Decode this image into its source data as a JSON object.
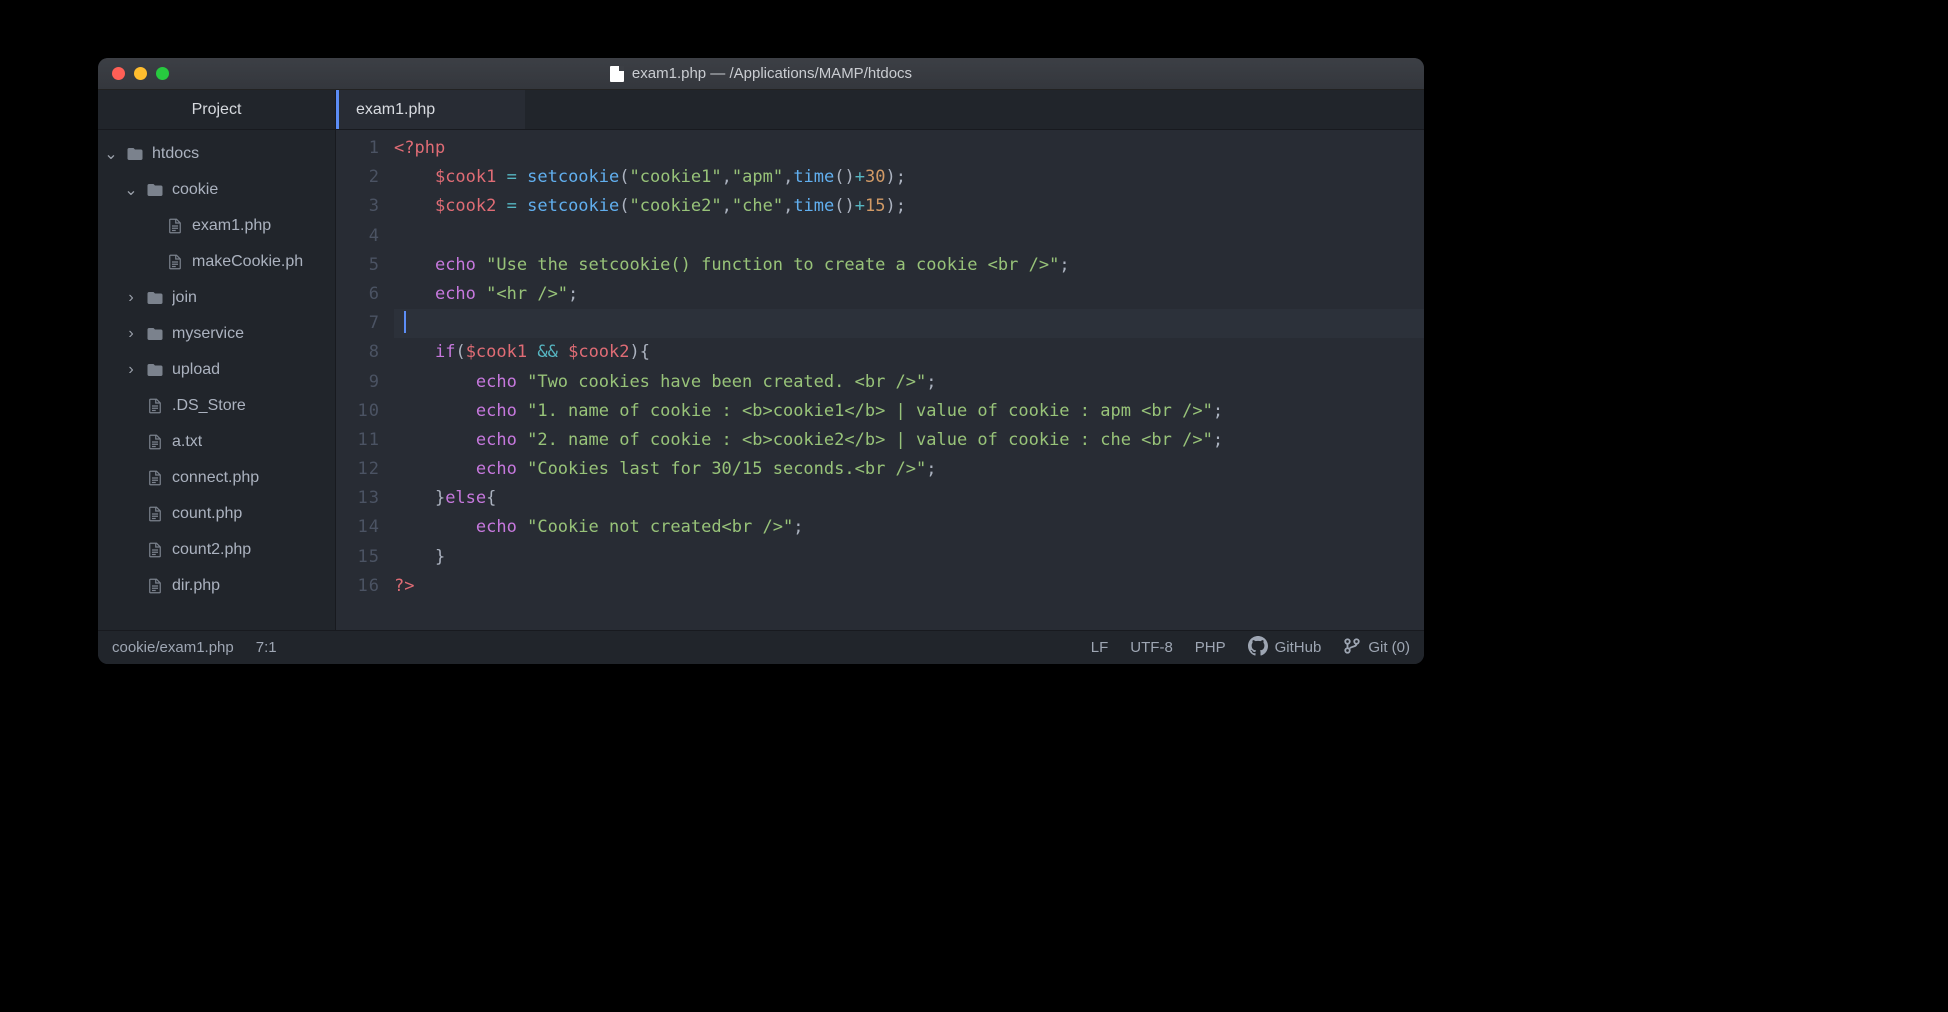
{
  "title": "exam1.php — /Applications/MAMP/htdocs",
  "sidebar": {
    "header": "Project",
    "tree": [
      {
        "type": "folder",
        "open": "down",
        "label": "htdocs",
        "depth": 0
      },
      {
        "type": "folder",
        "open": "down",
        "label": "cookie",
        "depth": 1
      },
      {
        "type": "file",
        "label": "exam1.php",
        "depth": 2
      },
      {
        "type": "file",
        "label": "makeCookie.ph",
        "depth": 2
      },
      {
        "type": "folder",
        "open": "right",
        "label": "join",
        "depth": 1
      },
      {
        "type": "folder",
        "open": "right",
        "label": "myservice",
        "depth": 1
      },
      {
        "type": "folder",
        "open": "right",
        "label": "upload",
        "depth": 1
      },
      {
        "type": "file",
        "label": ".DS_Store",
        "depth": 1
      },
      {
        "type": "file",
        "label": "a.txt",
        "depth": 1
      },
      {
        "type": "file",
        "label": "connect.php",
        "depth": 1
      },
      {
        "type": "file",
        "label": "count.php",
        "depth": 1
      },
      {
        "type": "file",
        "label": "count2.php",
        "depth": 1
      },
      {
        "type": "file",
        "label": "dir.php",
        "depth": 1
      }
    ]
  },
  "tab": {
    "label": "exam1.php"
  },
  "code_lines": 16,
  "current_line": 7,
  "code": {
    "l1": [
      {
        "t": "<?php",
        "c": "red"
      }
    ],
    "l2": [
      {
        "t": "    ",
        "c": "gray"
      },
      {
        "t": "$cook1",
        "c": "red"
      },
      {
        "t": " ",
        "c": "gray"
      },
      {
        "t": "=",
        "c": "cyan"
      },
      {
        "t": " ",
        "c": "gray"
      },
      {
        "t": "setcookie",
        "c": "blue"
      },
      {
        "t": "(",
        "c": "gray"
      },
      {
        "t": "\"cookie1\"",
        "c": "green"
      },
      {
        "t": ",",
        "c": "gray"
      },
      {
        "t": "\"apm\"",
        "c": "green"
      },
      {
        "t": ",",
        "c": "gray"
      },
      {
        "t": "time",
        "c": "blue"
      },
      {
        "t": "()",
        "c": "gray"
      },
      {
        "t": "+",
        "c": "cyan"
      },
      {
        "t": "30",
        "c": "orange"
      },
      {
        "t": ");",
        "c": "gray"
      }
    ],
    "l3": [
      {
        "t": "    ",
        "c": "gray"
      },
      {
        "t": "$cook2",
        "c": "red"
      },
      {
        "t": " ",
        "c": "gray"
      },
      {
        "t": "=",
        "c": "cyan"
      },
      {
        "t": " ",
        "c": "gray"
      },
      {
        "t": "setcookie",
        "c": "blue"
      },
      {
        "t": "(",
        "c": "gray"
      },
      {
        "t": "\"cookie2\"",
        "c": "green"
      },
      {
        "t": ",",
        "c": "gray"
      },
      {
        "t": "\"che\"",
        "c": "green"
      },
      {
        "t": ",",
        "c": "gray"
      },
      {
        "t": "time",
        "c": "blue"
      },
      {
        "t": "()",
        "c": "gray"
      },
      {
        "t": "+",
        "c": "cyan"
      },
      {
        "t": "15",
        "c": "orange"
      },
      {
        "t": ");",
        "c": "gray"
      }
    ],
    "l4": [],
    "l5": [
      {
        "t": "    ",
        "c": "gray"
      },
      {
        "t": "echo",
        "c": "purple"
      },
      {
        "t": " ",
        "c": "gray"
      },
      {
        "t": "\"Use the setcookie() function to create a cookie <br />\"",
        "c": "green"
      },
      {
        "t": ";",
        "c": "gray"
      }
    ],
    "l6": [
      {
        "t": "    ",
        "c": "gray"
      },
      {
        "t": "echo",
        "c": "purple"
      },
      {
        "t": " ",
        "c": "gray"
      },
      {
        "t": "\"<hr />\"",
        "c": "green"
      },
      {
        "t": ";",
        "c": "gray"
      }
    ],
    "l7": [],
    "l8": [
      {
        "t": "    ",
        "c": "gray"
      },
      {
        "t": "if",
        "c": "purple"
      },
      {
        "t": "(",
        "c": "gray"
      },
      {
        "t": "$cook1",
        "c": "red"
      },
      {
        "t": " ",
        "c": "gray"
      },
      {
        "t": "&&",
        "c": "cyan"
      },
      {
        "t": " ",
        "c": "gray"
      },
      {
        "t": "$cook2",
        "c": "red"
      },
      {
        "t": "){",
        "c": "gray"
      }
    ],
    "l9": [
      {
        "t": "        ",
        "c": "gray"
      },
      {
        "t": "echo",
        "c": "purple"
      },
      {
        "t": " ",
        "c": "gray"
      },
      {
        "t": "\"Two cookies have been created. <br />\"",
        "c": "green"
      },
      {
        "t": ";",
        "c": "gray"
      }
    ],
    "l10": [
      {
        "t": "        ",
        "c": "gray"
      },
      {
        "t": "echo",
        "c": "purple"
      },
      {
        "t": " ",
        "c": "gray"
      },
      {
        "t": "\"1. name of cookie : <b>cookie1</b> | value of cookie : apm <br />\"",
        "c": "green"
      },
      {
        "t": ";",
        "c": "gray"
      }
    ],
    "l11": [
      {
        "t": "        ",
        "c": "gray"
      },
      {
        "t": "echo",
        "c": "purple"
      },
      {
        "t": " ",
        "c": "gray"
      },
      {
        "t": "\"2. name of cookie : <b>cookie2</b> | value of cookie : che <br />\"",
        "c": "green"
      },
      {
        "t": ";",
        "c": "gray"
      }
    ],
    "l12": [
      {
        "t": "        ",
        "c": "gray"
      },
      {
        "t": "echo",
        "c": "purple"
      },
      {
        "t": " ",
        "c": "gray"
      },
      {
        "t": "\"Cookies last for 30/15 seconds.<br />\"",
        "c": "green"
      },
      {
        "t": ";",
        "c": "gray"
      }
    ],
    "l13": [
      {
        "t": "    }",
        "c": "gray"
      },
      {
        "t": "else",
        "c": "purple"
      },
      {
        "t": "{",
        "c": "gray"
      }
    ],
    "l14": [
      {
        "t": "        ",
        "c": "gray"
      },
      {
        "t": "echo",
        "c": "purple"
      },
      {
        "t": " ",
        "c": "gray"
      },
      {
        "t": "\"Cookie not created<br />\"",
        "c": "green"
      },
      {
        "t": ";",
        "c": "gray"
      }
    ],
    "l15": [
      {
        "t": "    }",
        "c": "gray"
      }
    ],
    "l16": [
      {
        "t": "?>",
        "c": "red"
      }
    ]
  },
  "status": {
    "path": "cookie/exam1.php",
    "pos": "7:1",
    "eol": "LF",
    "encoding": "UTF-8",
    "lang": "PHP",
    "github": "GitHub",
    "git": "Git (0)"
  }
}
